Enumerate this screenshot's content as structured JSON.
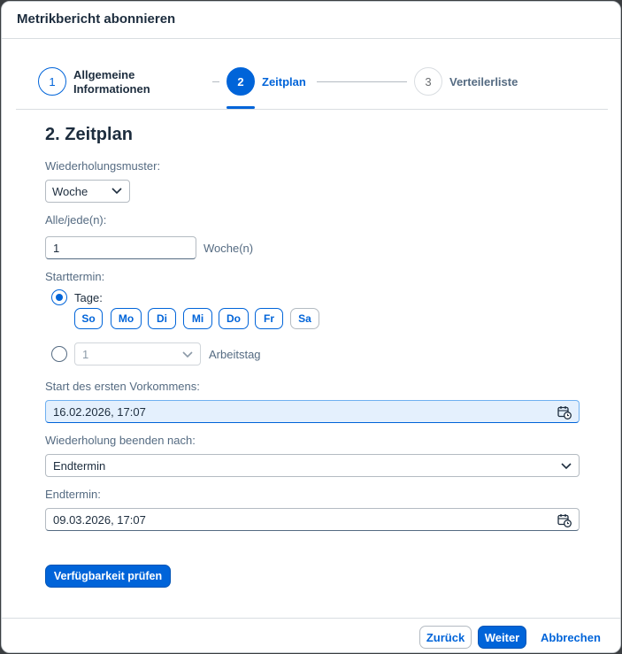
{
  "dialog": {
    "title": "Metrikbericht abonnieren"
  },
  "steps": [
    {
      "number": "1",
      "label_line1": "Allgemeine",
      "label_line2": "Informationen"
    },
    {
      "number": "2",
      "label": "Zeitplan"
    },
    {
      "number": "3",
      "label": "Verteilerliste"
    }
  ],
  "form": {
    "section_title": "2. Zeitplan",
    "recurrence_label": "Wiederholungsmuster:",
    "recurrence_value": "Woche",
    "every_label": "Alle/jede(n):",
    "every_value": "1",
    "every_unit": "Woche(n)",
    "start_label": "Starttermin:",
    "days_option_label": "Tage:",
    "days": [
      "So",
      "Mo",
      "Di",
      "Mi",
      "Do",
      "Fr",
      "Sa"
    ],
    "workday_value": "1",
    "workday_label": "Arbeitstag",
    "first_occurrence_label": "Start des ersten Vorkommens:",
    "first_occurrence_value": "16.02.2026, 17:07",
    "end_after_label": "Wiederholung beenden nach:",
    "end_after_value": "Endtermin",
    "end_date_label": "Endtermin:",
    "end_date_value": "09.03.2026, 17:07",
    "check_button": "Verfügbarkeit prüfen"
  },
  "footer": {
    "back": "Zurück",
    "next": "Weiter",
    "cancel": "Abbrechen"
  },
  "colors": {
    "accent": "#0064d9",
    "focus_bg": "#e4f0fd"
  }
}
